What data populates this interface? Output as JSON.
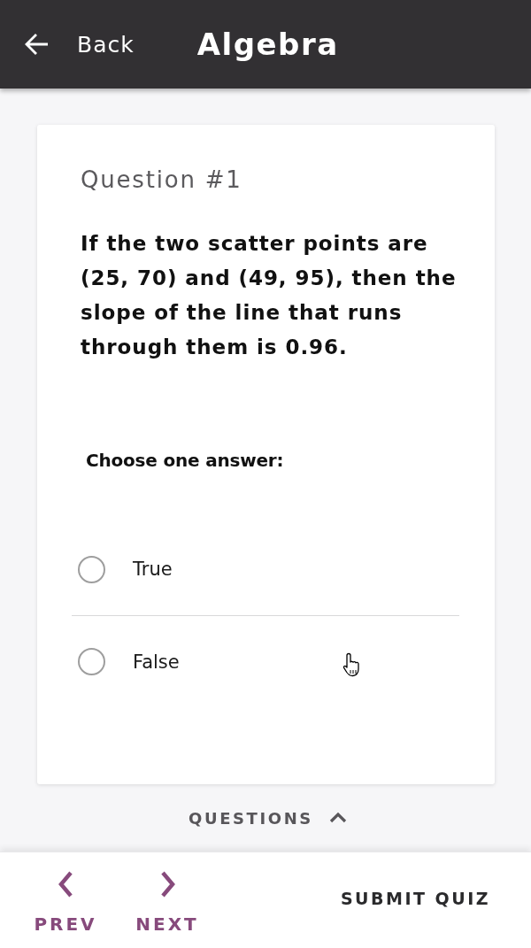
{
  "header": {
    "back_label": "Back",
    "title": "Algebra"
  },
  "question": {
    "number_label": "Question #1",
    "text": "If the two scatter points are (25, 70) and (49, 95), then the slope of the line that runs through them is 0.96.",
    "prompt": "Choose one answer:",
    "options": [
      {
        "label": "True",
        "selected": false
      },
      {
        "label": "False",
        "selected": false
      }
    ]
  },
  "questions_toggle": {
    "label": "QUESTIONS",
    "expanded": false
  },
  "footer": {
    "prev_label": "PREV",
    "next_label": "NEXT",
    "submit_label": "SUBMIT QUIZ"
  }
}
